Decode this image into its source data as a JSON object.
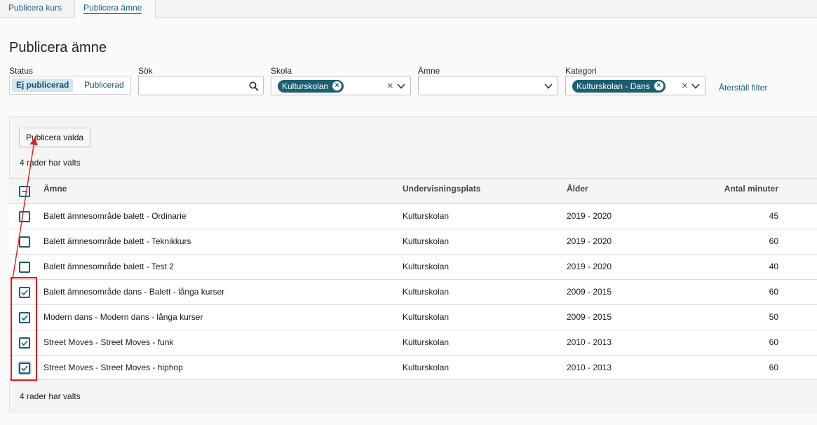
{
  "tabs": [
    {
      "label": "Publicera kurs"
    },
    {
      "label": "Publicera ämne"
    }
  ],
  "page_title": "Publicera ämne",
  "filters": {
    "status": {
      "label": "Status",
      "options": [
        "Ej publicerad",
        "Publicerad"
      ],
      "selected": "Ej publicerad"
    },
    "search": {
      "label": "Sök",
      "value": "",
      "placeholder": ""
    },
    "skola": {
      "label": "Skola",
      "chip": "Kulturskolan"
    },
    "amne": {
      "label": "Ämne",
      "value": ""
    },
    "kategori": {
      "label": "Kategori",
      "chip": "Kulturskolan - Dans"
    },
    "reset_label": "Återställ filter"
  },
  "publish_button": "Publicera valda",
  "rows_selected_text": "4 rader har valts",
  "table": {
    "headers": [
      "Ämne",
      "Undervisningsplats",
      "Ålder",
      "Antal minuter"
    ],
    "header_checkbox_state": "indeterminate",
    "rows": [
      {
        "name": "Balett ämnesområde balett - Ordinarie",
        "place": "Kulturskolan",
        "age": "2019 - 2020",
        "minutes": "45",
        "checked": false
      },
      {
        "name": "Balett ämnesområde balett - Teknikkurs",
        "place": "Kulturskolan",
        "age": "2019 - 2020",
        "minutes": "60",
        "checked": false
      },
      {
        "name": "Balett ämnesområde balett - Test 2",
        "place": "Kulturskolan",
        "age": "2019 - 2020",
        "minutes": "40",
        "checked": false
      },
      {
        "name": "Balett ämnesområde dans - Balett - långa kurser",
        "place": "Kulturskolan",
        "age": "2009 - 2015",
        "minutes": "60",
        "checked": true
      },
      {
        "name": "Modern dans - Modern dans - långa kurser",
        "place": "Kulturskolan",
        "age": "2009 - 2015",
        "minutes": "50",
        "checked": true
      },
      {
        "name": "Street Moves - Street Moves - funk",
        "place": "Kulturskolan",
        "age": "2010 - 2013",
        "minutes": "60",
        "checked": true
      },
      {
        "name": "Street Moves - Street Moves - hiphop",
        "place": "Kulturskolan",
        "age": "2010 - 2013",
        "minutes": "60",
        "checked": true
      }
    ]
  },
  "colors": {
    "accent": "#1b5f70",
    "link": "#1a5e86",
    "annotation": "#e01b1b"
  }
}
